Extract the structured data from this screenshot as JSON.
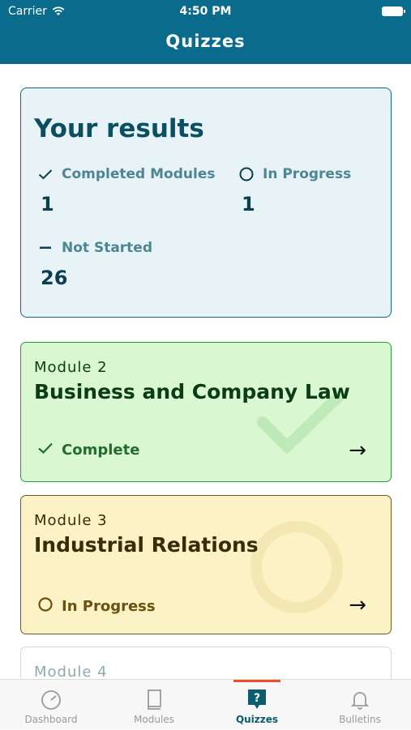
{
  "status_bar": {
    "carrier": "Carrier",
    "time": "4:50 PM"
  },
  "header": {
    "title": "Quizzes"
  },
  "results": {
    "heading": "Your results",
    "completed": {
      "label": "Completed Modules",
      "value": "1",
      "icon": "checkmark-icon"
    },
    "in_progress": {
      "label": "In Progress",
      "value": "1",
      "icon": "circle-icon"
    },
    "not_started": {
      "label": "Not Started",
      "value": "26",
      "icon": "dash-icon"
    }
  },
  "modules": [
    {
      "number": "Module 2",
      "name": "Business and Company Law",
      "status": "Complete",
      "status_icon": "checkmark-icon",
      "color": "#d9f8d2"
    },
    {
      "number": "Module 3",
      "name": "Industrial Relations",
      "status": "In Progress",
      "status_icon": "circle-icon",
      "color": "#fbf2c6"
    },
    {
      "number": "Module 4"
    }
  ],
  "tabs": [
    {
      "label": "Dashboard",
      "icon": "gauge-icon"
    },
    {
      "label": "Modules",
      "icon": "book-icon"
    },
    {
      "label": "Quizzes",
      "icon": "quiz-icon",
      "active": true
    },
    {
      "label": "Bulletins",
      "icon": "bell-icon"
    }
  ],
  "colors": {
    "header": "#0b6b8c",
    "accent": "#e8502e",
    "complete": "#2e9a44",
    "in_progress": "#6e5b27"
  }
}
